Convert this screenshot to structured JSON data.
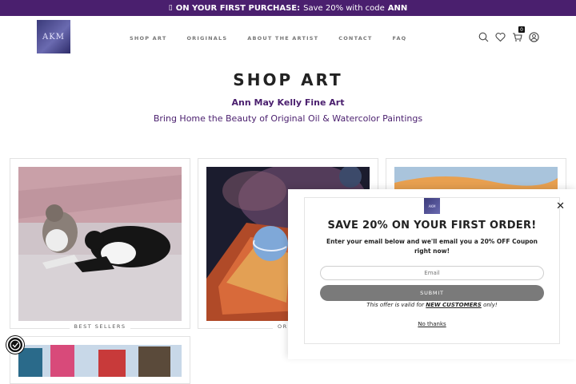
{
  "announcement": {
    "icon": "gift-icon",
    "bold_text": "ON YOUR FIRST PURCHASE:",
    "text": "Save 20% with code",
    "code": "ANN"
  },
  "header": {
    "logo_text": "AKM",
    "nav": [
      "SHOP ART",
      "ORIGINALS",
      "ABOUT THE ARTIST",
      "CONTACT",
      "FAQ"
    ],
    "cart_count": "0"
  },
  "main": {
    "title": "SHOP ART",
    "brand": "Ann May Kelly Fine Art",
    "tagline": "Bring Home the Beauty of Original Oil & Watercolor Paintings",
    "cards": [
      {
        "caption": "BEST SELLERS"
      },
      {
        "caption": "ORIGI"
      }
    ]
  },
  "popup": {
    "title": "SAVE 20% ON YOUR FIRST ORDER!",
    "text": "Enter your email below and we'll email you a 20% OFF Coupon right now!",
    "email_placeholder": "Email",
    "submit_label": "SUBMIT",
    "offer_prefix": "This offer is valid for",
    "offer_emph": "NEW CUSTOMERS",
    "offer_suffix": "only!",
    "no_thanks": "No thanks"
  },
  "colors": {
    "brand_purple": "#4a1f6e",
    "submit_gray": "#7a7a7a"
  }
}
